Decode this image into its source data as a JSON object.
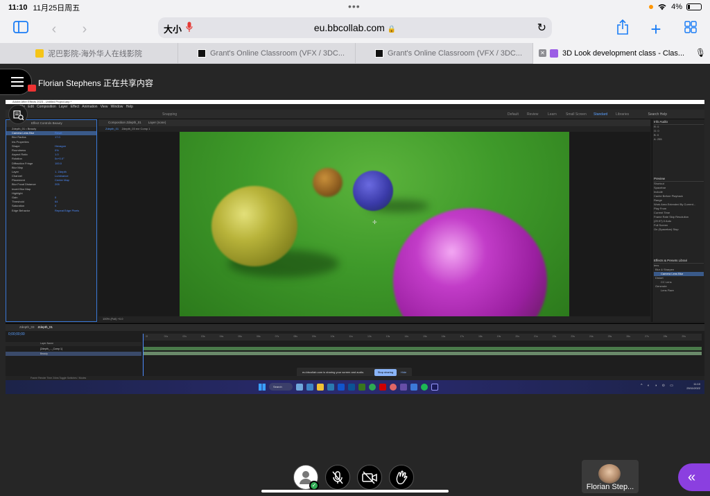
{
  "status_bar": {
    "time": "11:10",
    "date": "11月25日周五",
    "battery": "4%"
  },
  "toolbar": {
    "text_size": "大小",
    "url": "eu.bbcollab.com"
  },
  "tabs": [
    {
      "label": "泥巴影院-海外华人在线影院",
      "favicon": "mud-icon"
    },
    {
      "label": "Grant's Online Classroom (VFX / 3DC...",
      "favicon": "grant-icon"
    },
    {
      "label": "Grant's Online Classroom (VFX / 3DC...",
      "favicon": "grant-icon"
    },
    {
      "label": "3D Look development class - Clas...",
      "favicon": "collab-icon",
      "active": true
    }
  ],
  "collab": {
    "sharing_text": "Florian Stephens 正在共享内容"
  },
  "shared_screen": {
    "ae_title": "Adobe After Effects 2023 - Untitled Project.aep *",
    "ae_menu": [
      "File",
      "Edit",
      "Composition",
      "Layer",
      "Effect",
      "Animation",
      "View",
      "Window",
      "Help"
    ],
    "workspaces": [
      "Snapping",
      "Default",
      "Review",
      "Learn",
      "Small Screen",
      "Standard",
      "Libraries"
    ],
    "search_help": "Search Help",
    "effect_panel": {
      "header": "Effect Controls Beauty",
      "crumb": "Zdepth_01 • Beauty",
      "rows": [
        {
          "label": "Camera Lens Blur",
          "value": "Reset",
          "selected": true
        },
        {
          "label": "Blur Radius",
          "value": "17.0"
        },
        {
          "label": "Iris Properties",
          "value": ""
        },
        {
          "label": "Shape",
          "value": "Hexagon"
        },
        {
          "label": "Roundness",
          "value": "0%"
        },
        {
          "label": "Aspect Ratio",
          "value": "1.0"
        },
        {
          "label": "Rotation",
          "value": "0x+0.0°"
        },
        {
          "label": "Diffraction Fringe",
          "value": "100.0"
        },
        {
          "label": "Blur Map",
          "value": ""
        },
        {
          "label": "Layer",
          "value": "1. Zdepth"
        },
        {
          "label": "Channel",
          "value": "Luminance"
        },
        {
          "label": "Placement",
          "value": "Center Map"
        },
        {
          "label": "Blur Focal Distance",
          "value": "205"
        },
        {
          "label": "Invert Blur Map",
          "value": ""
        },
        {
          "label": "Highlight",
          "value": ""
        },
        {
          "label": "Gain",
          "value": "0"
        },
        {
          "label": "Threshold",
          "value": "64"
        },
        {
          "label": "Saturation",
          "value": "0"
        },
        {
          "label": "Edge Behavior",
          "value": "Repeat Edge Pixels"
        }
      ]
    },
    "composition": {
      "header": "Composition Zdepth_01",
      "tabs": [
        "Zdepth_01",
        "Zdepth_03 exr Comp 1"
      ],
      "layer_label": "Layer (none)",
      "footer": "100%   (Full)   +0.0"
    },
    "right_panels": {
      "info": "Info   Audio",
      "info_values": [
        "R: 0",
        "G: 0",
        "B: 0",
        "A: 255"
      ],
      "preview_header": "Preview",
      "preview_rows": [
        "Shortcut",
        "Spacebar",
        "Include",
        "Cache Before Playback",
        "Range",
        "Work Area Extended By Current...",
        "Play From",
        "Current Time",
        "Frame Rate   Skip   Resolution",
        "(29.97)   0   Auto",
        "Full Screen",
        "On (Spacebar) Stop"
      ],
      "effects_header": "Effects & Presets  Librari",
      "effects_search": "lens",
      "effects_rows": [
        "Blur & Sharpen",
        "Camera Lens Blur",
        "Distort",
        "CC Lens",
        "Generate",
        "Lens Flare"
      ]
    },
    "timeline": {
      "tabs": [
        "Zdepth_03",
        "Zdepth_01"
      ],
      "timecode": "0;00;00;00",
      "header": "Layer Name",
      "layers": [
        "[Zdepth_..._Comp 1]",
        "Beauty"
      ],
      "ruler": [
        "0f",
        "01s",
        "02s",
        "03s",
        "04s",
        "05s",
        "06s",
        "07s",
        "08s",
        "09s",
        "10s",
        "11s",
        "12s",
        "13s",
        "14s",
        "15s",
        "16s",
        "17s",
        "18s",
        "19s",
        "20s",
        "21s",
        "22s",
        "23s",
        "24s",
        "25s",
        "26s",
        "27s",
        "28s",
        "29s"
      ],
      "bottom": "Frame Render Time  24ms       Toggle Switches / Modes"
    },
    "share_notice": {
      "text": "eu.bbcollab.com is sharing your screen and audio.",
      "stop": "Stop sharing",
      "hide": "Hide"
    },
    "taskbar": {
      "search": "Search",
      "time": "11:10",
      "date": "25/11/2022"
    }
  },
  "bottom": {
    "participant_name": "Florian Step..."
  }
}
